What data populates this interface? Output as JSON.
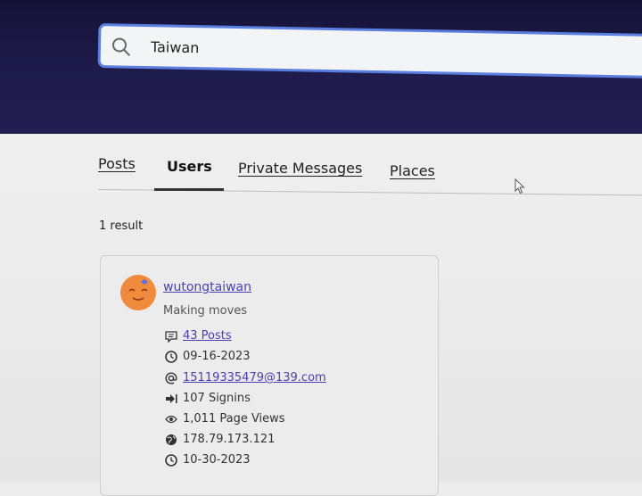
{
  "search": {
    "value": "Taiwan"
  },
  "tabs": [
    {
      "label": "Posts"
    },
    {
      "label": "Users"
    },
    {
      "label": "Private Messages"
    },
    {
      "label": "Places"
    }
  ],
  "results": {
    "count_label": "1 result",
    "user": {
      "username": "wutongtaiwan",
      "tagline": "Making moves",
      "stats": [
        {
          "icon": "speech-bubble-icon",
          "text": "43 Posts"
        },
        {
          "icon": "clock-icon",
          "text": "09-16-2023"
        },
        {
          "icon": "at-sign-icon",
          "text": "15119335479@139.com"
        },
        {
          "icon": "sign-in-arrow-icon",
          "text": "107 Signins"
        },
        {
          "icon": "eye-icon",
          "text": "1,011 Page Views"
        },
        {
          "icon": "globe-icon",
          "text": "178.79.173.121"
        },
        {
          "icon": "clock-icon",
          "text": "10-30-2023"
        }
      ]
    }
  },
  "colors": {
    "header_bg": "#1f1c4d",
    "search_border": "#5a7fe0",
    "link": "#4a3fb0",
    "avatar": "#f08a3c"
  }
}
